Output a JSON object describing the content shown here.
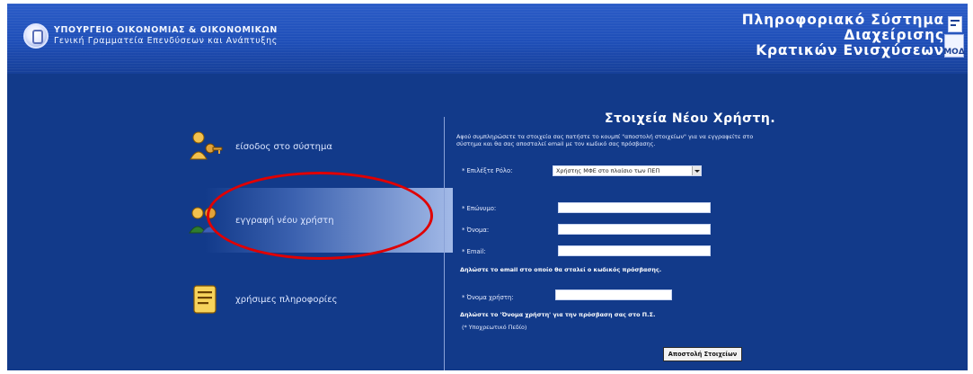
{
  "header": {
    "ministry_line1": "ΥΠΟΥΡΓΕΙΟ ΟΙΚΟΝΟΜΙΑΣ & ΟΙΚΟΝΟΜΙΚΩΝ",
    "ministry_line2": "Γενική Γραμματεία Επενδύσεων και Ανάπτυξης",
    "system_line1": "Πληροφοριακό Σύστημα",
    "system_line2": "Διαχείρισης",
    "system_line3": "Κρατικών Ενισχύσεων",
    "logo_text": "ΜΟΔ"
  },
  "nav": {
    "items": [
      {
        "label": "είσοδος στο σύστημα",
        "icon": "user-key-icon"
      },
      {
        "label": "εγγραφή νέου χρήστη",
        "icon": "users-icon"
      },
      {
        "label": "χρήσιμες πληροφορίες",
        "icon": "notepad-icon"
      }
    ],
    "active_index": 1
  },
  "form": {
    "title": "Στοιχεία Νέου Χρήστη.",
    "intro": "Αφού συμπληρώσετε τα στοιχεία σας πατήστε το κουμπί \"αποστολή στοιχείων\" για να εγγραφείτε στο σύστημα και θα σας αποσταλεί email με τον κωδικό σας πρόσβασης.",
    "role_label": "* Επιλέξτε Ρόλο:",
    "role_value": "Χρήστης ΜΦΕ στο πλαίσιο των ΠΕΠ",
    "surname_label": "* Επώνυμο:",
    "name_label": "* Όνομα:",
    "email_label": "* Email:",
    "email_note": "Δηλώστε το email στο οποίο θα σταλεί ο κωδικός πρόσβασης.",
    "username_label": "* Όνομα χρήστη:",
    "username_note": "Δηλώστε το 'Όνομα χρήστη' για την πρόσβαση σας στο Π.Σ.",
    "required_note": "(* Υποχρεωτικό Πεδίο)",
    "submit_label": "Αποστολή Στοιχείων"
  },
  "colors": {
    "page_bg": "#123a8a",
    "header_bg": "#1f4fb8",
    "highlight": "#aac0ec",
    "annotation": "#e00000"
  }
}
